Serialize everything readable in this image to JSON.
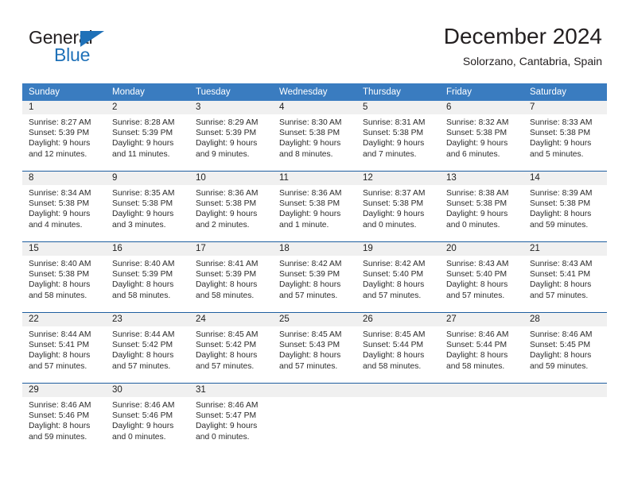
{
  "brand": {
    "name_top": "General",
    "name_bottom": "Blue",
    "triangle_color": "#1f71b8",
    "text_color": "#231f20"
  },
  "header": {
    "month_title": "December 2024",
    "location": "Solorzano, Cantabria, Spain"
  },
  "theme": {
    "header_bg": "#3a7cc0",
    "header_text": "#ffffff",
    "row_divider": "#1f5fa0",
    "daynum_band_bg": "#f0f0f0",
    "body_text": "#2b2b2b"
  },
  "weekday_headers": [
    "Sunday",
    "Monday",
    "Tuesday",
    "Wednesday",
    "Thursday",
    "Friday",
    "Saturday"
  ],
  "weeks": [
    [
      {
        "day": "1",
        "sunrise": "Sunrise: 8:27 AM",
        "sunset": "Sunset: 5:39 PM",
        "daylight_line1": "Daylight: 9 hours",
        "daylight_line2": "and 12 minutes."
      },
      {
        "day": "2",
        "sunrise": "Sunrise: 8:28 AM",
        "sunset": "Sunset: 5:39 PM",
        "daylight_line1": "Daylight: 9 hours",
        "daylight_line2": "and 11 minutes."
      },
      {
        "day": "3",
        "sunrise": "Sunrise: 8:29 AM",
        "sunset": "Sunset: 5:39 PM",
        "daylight_line1": "Daylight: 9 hours",
        "daylight_line2": "and 9 minutes."
      },
      {
        "day": "4",
        "sunrise": "Sunrise: 8:30 AM",
        "sunset": "Sunset: 5:38 PM",
        "daylight_line1": "Daylight: 9 hours",
        "daylight_line2": "and 8 minutes."
      },
      {
        "day": "5",
        "sunrise": "Sunrise: 8:31 AM",
        "sunset": "Sunset: 5:38 PM",
        "daylight_line1": "Daylight: 9 hours",
        "daylight_line2": "and 7 minutes."
      },
      {
        "day": "6",
        "sunrise": "Sunrise: 8:32 AM",
        "sunset": "Sunset: 5:38 PM",
        "daylight_line1": "Daylight: 9 hours",
        "daylight_line2": "and 6 minutes."
      },
      {
        "day": "7",
        "sunrise": "Sunrise: 8:33 AM",
        "sunset": "Sunset: 5:38 PM",
        "daylight_line1": "Daylight: 9 hours",
        "daylight_line2": "and 5 minutes."
      }
    ],
    [
      {
        "day": "8",
        "sunrise": "Sunrise: 8:34 AM",
        "sunset": "Sunset: 5:38 PM",
        "daylight_line1": "Daylight: 9 hours",
        "daylight_line2": "and 4 minutes."
      },
      {
        "day": "9",
        "sunrise": "Sunrise: 8:35 AM",
        "sunset": "Sunset: 5:38 PM",
        "daylight_line1": "Daylight: 9 hours",
        "daylight_line2": "and 3 minutes."
      },
      {
        "day": "10",
        "sunrise": "Sunrise: 8:36 AM",
        "sunset": "Sunset: 5:38 PM",
        "daylight_line1": "Daylight: 9 hours",
        "daylight_line2": "and 2 minutes."
      },
      {
        "day": "11",
        "sunrise": "Sunrise: 8:36 AM",
        "sunset": "Sunset: 5:38 PM",
        "daylight_line1": "Daylight: 9 hours",
        "daylight_line2": "and 1 minute."
      },
      {
        "day": "12",
        "sunrise": "Sunrise: 8:37 AM",
        "sunset": "Sunset: 5:38 PM",
        "daylight_line1": "Daylight: 9 hours",
        "daylight_line2": "and 0 minutes."
      },
      {
        "day": "13",
        "sunrise": "Sunrise: 8:38 AM",
        "sunset": "Sunset: 5:38 PM",
        "daylight_line1": "Daylight: 9 hours",
        "daylight_line2": "and 0 minutes."
      },
      {
        "day": "14",
        "sunrise": "Sunrise: 8:39 AM",
        "sunset": "Sunset: 5:38 PM",
        "daylight_line1": "Daylight: 8 hours",
        "daylight_line2": "and 59 minutes."
      }
    ],
    [
      {
        "day": "15",
        "sunrise": "Sunrise: 8:40 AM",
        "sunset": "Sunset: 5:38 PM",
        "daylight_line1": "Daylight: 8 hours",
        "daylight_line2": "and 58 minutes."
      },
      {
        "day": "16",
        "sunrise": "Sunrise: 8:40 AM",
        "sunset": "Sunset: 5:39 PM",
        "daylight_line1": "Daylight: 8 hours",
        "daylight_line2": "and 58 minutes."
      },
      {
        "day": "17",
        "sunrise": "Sunrise: 8:41 AM",
        "sunset": "Sunset: 5:39 PM",
        "daylight_line1": "Daylight: 8 hours",
        "daylight_line2": "and 58 minutes."
      },
      {
        "day": "18",
        "sunrise": "Sunrise: 8:42 AM",
        "sunset": "Sunset: 5:39 PM",
        "daylight_line1": "Daylight: 8 hours",
        "daylight_line2": "and 57 minutes."
      },
      {
        "day": "19",
        "sunrise": "Sunrise: 8:42 AM",
        "sunset": "Sunset: 5:40 PM",
        "daylight_line1": "Daylight: 8 hours",
        "daylight_line2": "and 57 minutes."
      },
      {
        "day": "20",
        "sunrise": "Sunrise: 8:43 AM",
        "sunset": "Sunset: 5:40 PM",
        "daylight_line1": "Daylight: 8 hours",
        "daylight_line2": "and 57 minutes."
      },
      {
        "day": "21",
        "sunrise": "Sunrise: 8:43 AM",
        "sunset": "Sunset: 5:41 PM",
        "daylight_line1": "Daylight: 8 hours",
        "daylight_line2": "and 57 minutes."
      }
    ],
    [
      {
        "day": "22",
        "sunrise": "Sunrise: 8:44 AM",
        "sunset": "Sunset: 5:41 PM",
        "daylight_line1": "Daylight: 8 hours",
        "daylight_line2": "and 57 minutes."
      },
      {
        "day": "23",
        "sunrise": "Sunrise: 8:44 AM",
        "sunset": "Sunset: 5:42 PM",
        "daylight_line1": "Daylight: 8 hours",
        "daylight_line2": "and 57 minutes."
      },
      {
        "day": "24",
        "sunrise": "Sunrise: 8:45 AM",
        "sunset": "Sunset: 5:42 PM",
        "daylight_line1": "Daylight: 8 hours",
        "daylight_line2": "and 57 minutes."
      },
      {
        "day": "25",
        "sunrise": "Sunrise: 8:45 AM",
        "sunset": "Sunset: 5:43 PM",
        "daylight_line1": "Daylight: 8 hours",
        "daylight_line2": "and 57 minutes."
      },
      {
        "day": "26",
        "sunrise": "Sunrise: 8:45 AM",
        "sunset": "Sunset: 5:44 PM",
        "daylight_line1": "Daylight: 8 hours",
        "daylight_line2": "and 58 minutes."
      },
      {
        "day": "27",
        "sunrise": "Sunrise: 8:46 AM",
        "sunset": "Sunset: 5:44 PM",
        "daylight_line1": "Daylight: 8 hours",
        "daylight_line2": "and 58 minutes."
      },
      {
        "day": "28",
        "sunrise": "Sunrise: 8:46 AM",
        "sunset": "Sunset: 5:45 PM",
        "daylight_line1": "Daylight: 8 hours",
        "daylight_line2": "and 59 minutes."
      }
    ],
    [
      {
        "day": "29",
        "sunrise": "Sunrise: 8:46 AM",
        "sunset": "Sunset: 5:46 PM",
        "daylight_line1": "Daylight: 8 hours",
        "daylight_line2": "and 59 minutes."
      },
      {
        "day": "30",
        "sunrise": "Sunrise: 8:46 AM",
        "sunset": "Sunset: 5:46 PM",
        "daylight_line1": "Daylight: 9 hours",
        "daylight_line2": "and 0 minutes."
      },
      {
        "day": "31",
        "sunrise": "Sunrise: 8:46 AM",
        "sunset": "Sunset: 5:47 PM",
        "daylight_line1": "Daylight: 9 hours",
        "daylight_line2": "and 0 minutes."
      },
      {
        "day": "",
        "sunrise": "",
        "sunset": "",
        "daylight_line1": "",
        "daylight_line2": ""
      },
      {
        "day": "",
        "sunrise": "",
        "sunset": "",
        "daylight_line1": "",
        "daylight_line2": ""
      },
      {
        "day": "",
        "sunrise": "",
        "sunset": "",
        "daylight_line1": "",
        "daylight_line2": ""
      },
      {
        "day": "",
        "sunrise": "",
        "sunset": "",
        "daylight_line1": "",
        "daylight_line2": ""
      }
    ]
  ]
}
